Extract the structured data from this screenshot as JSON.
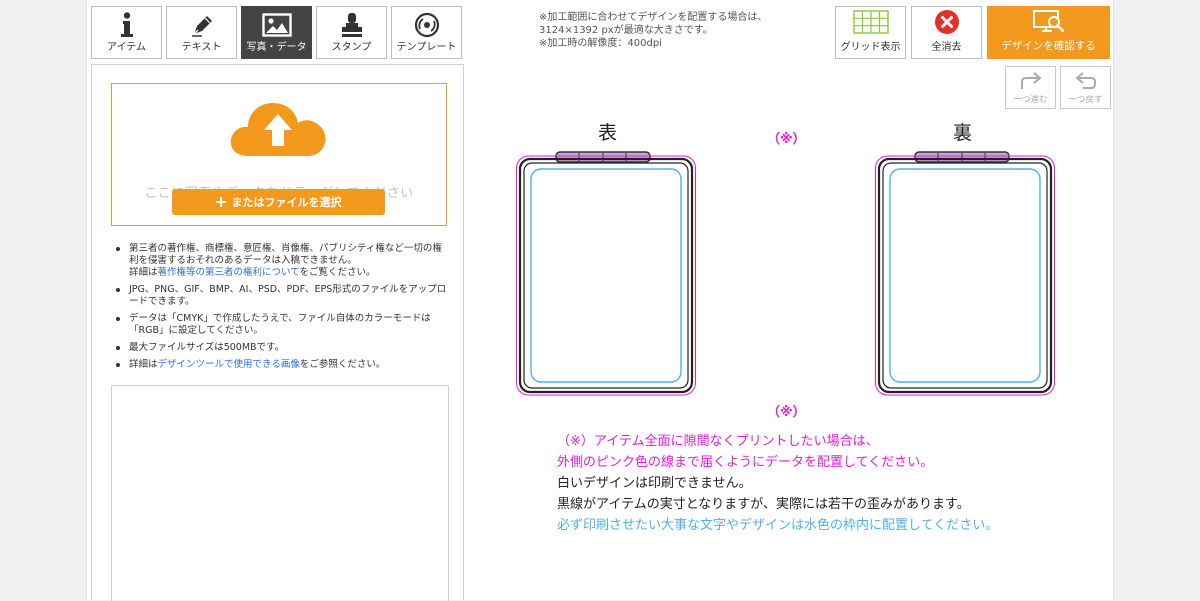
{
  "tabs": [
    {
      "label": "アイテム",
      "icon": "info-icon",
      "active": false
    },
    {
      "label": "テキスト",
      "icon": "pen-icon",
      "active": false
    },
    {
      "label": "写真・データ",
      "icon": "image-icon",
      "active": true
    },
    {
      "label": "スタンプ",
      "icon": "stamp-icon",
      "active": false
    },
    {
      "label": "テンプレート",
      "icon": "template-icon",
      "active": false
    }
  ],
  "upload": {
    "drop_text": "ここに写真やデータをドラッグしてください",
    "file_button": "またはファイルを選択"
  },
  "notes": [
    {
      "text": "第三者の著作権、商標権、意匠権、肖像権、パブリシティ権など一切の権利を侵害するおそれのあるデータは入稿できません。",
      "pre": "詳細は",
      "link": "著作権等の第三者の権利について",
      "post": "をご覧ください。"
    },
    {
      "text": "JPG、PNG、GIF、BMP、AI、PSD、PDF、EPS形式のファイルをアップロードできます。"
    },
    {
      "text": "データは「CMYK」で作成したうえで、ファイル自体のカラーモードは「RGB」に設定してください。"
    },
    {
      "text": "最大ファイルサイズは500MBです。"
    },
    {
      "pre": "詳細は",
      "link": "デザインツールで使用できる画像",
      "post": "をご参照ください。"
    }
  ],
  "info": {
    "line1": "※加工範囲に合わせてデザインを配置する場合は、",
    "line2": "3124×1392 pxが最適な大きさです。",
    "line3": "※加工時の解像度：400dpi"
  },
  "toolbar": {
    "grid_label": "グリッド表示",
    "clear_label": "全消去",
    "confirm_label": "デザインを確認する",
    "redo_label": "一つ進む",
    "undo_label": "一つ戻す"
  },
  "canvas": {
    "front_label": "表",
    "back_label": "裏",
    "mark_top": "（※）",
    "mark_bottom": "（※）"
  },
  "messages": {
    "pink1": "（※）アイテム全面に隙間なくプリントしたい場合は、",
    "pink2": "外側のピンク色の線まで届くようにデータを配置してください。",
    "black1": "白いデザインは印刷できません。",
    "black2": "黒線がアイテムの実寸となりますが、実際には若干の歪みがあります。",
    "blue1": "必ず印刷させたい大事な文字やデザインは水色の枠内に配置してください。"
  },
  "colors": {
    "accent": "#f39a1e",
    "bleed_line": "#e21ed8",
    "safe_line": "#4db3e6",
    "active_tab": "#444444"
  }
}
